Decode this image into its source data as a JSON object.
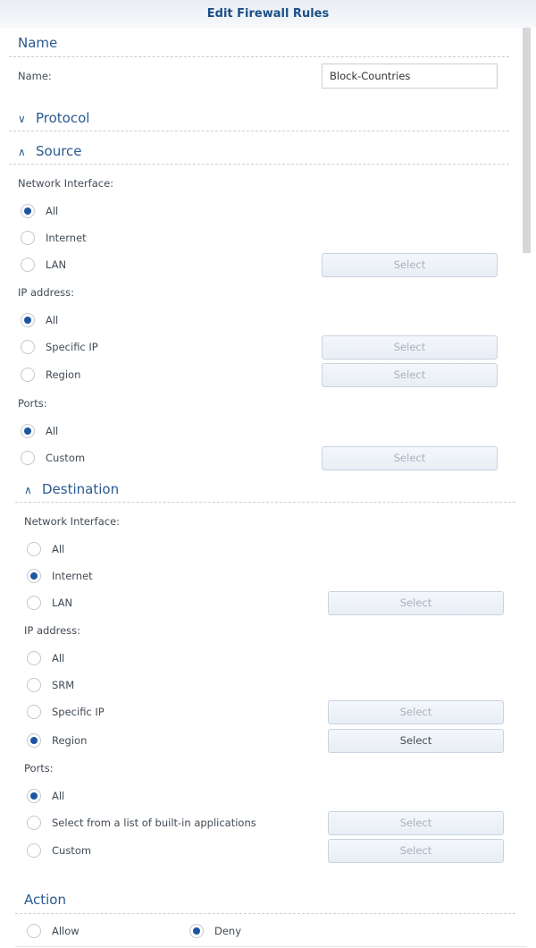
{
  "window": {
    "title": "Edit Firewall Rules"
  },
  "name_section": {
    "title": "Name",
    "field_label": "Name:",
    "field_value": "Block-Countries"
  },
  "protocol_section": {
    "title": "Protocol",
    "expanded": false,
    "chevron": "chevron-down"
  },
  "source_section": {
    "title": "Source",
    "expanded": true,
    "chevron": "chevron-up",
    "network_interface": {
      "label": "Network Interface:",
      "options": [
        {
          "label": "All",
          "selected": true
        },
        {
          "label": "Internet",
          "selected": false
        },
        {
          "label": "LAN",
          "selected": false,
          "button": "Select",
          "button_enabled": false
        }
      ]
    },
    "ip_address": {
      "label": "IP address:",
      "options": [
        {
          "label": "All",
          "selected": true
        },
        {
          "label": "Specific IP",
          "selected": false,
          "button": "Select",
          "button_enabled": false
        },
        {
          "label": "Region",
          "selected": false,
          "button": "Select",
          "button_enabled": false
        }
      ]
    },
    "ports": {
      "label": "Ports:",
      "options": [
        {
          "label": "All",
          "selected": true
        },
        {
          "label": "Custom",
          "selected": false,
          "button": "Select",
          "button_enabled": false
        }
      ]
    }
  },
  "destination_section": {
    "title": "Destination",
    "expanded": true,
    "chevron": "chevron-up",
    "network_interface": {
      "label": "Network Interface:",
      "options": [
        {
          "label": "All",
          "selected": false
        },
        {
          "label": "Internet",
          "selected": true
        },
        {
          "label": "LAN",
          "selected": false,
          "button": "Select",
          "button_enabled": false
        }
      ]
    },
    "ip_address": {
      "label": "IP address:",
      "options": [
        {
          "label": "All",
          "selected": false
        },
        {
          "label": "SRM",
          "selected": false
        },
        {
          "label": "Specific IP",
          "selected": false,
          "button": "Select",
          "button_enabled": false
        },
        {
          "label": "Region",
          "selected": true,
          "button": "Select",
          "button_enabled": true
        }
      ]
    },
    "ports": {
      "label": "Ports:",
      "options": [
        {
          "label": "All",
          "selected": true
        },
        {
          "label": "Select from a list of built-in applications",
          "selected": false,
          "button": "Select",
          "button_enabled": false
        },
        {
          "label": "Custom",
          "selected": false,
          "button": "Select",
          "button_enabled": false
        }
      ]
    }
  },
  "action_section": {
    "title": "Action",
    "options": [
      {
        "label": "Allow",
        "selected": false
      },
      {
        "label": "Deny",
        "selected": true
      }
    ]
  },
  "colors": {
    "accent": "#1d55a0",
    "heading": "#2a5a8f",
    "title": "#1c4f86"
  }
}
